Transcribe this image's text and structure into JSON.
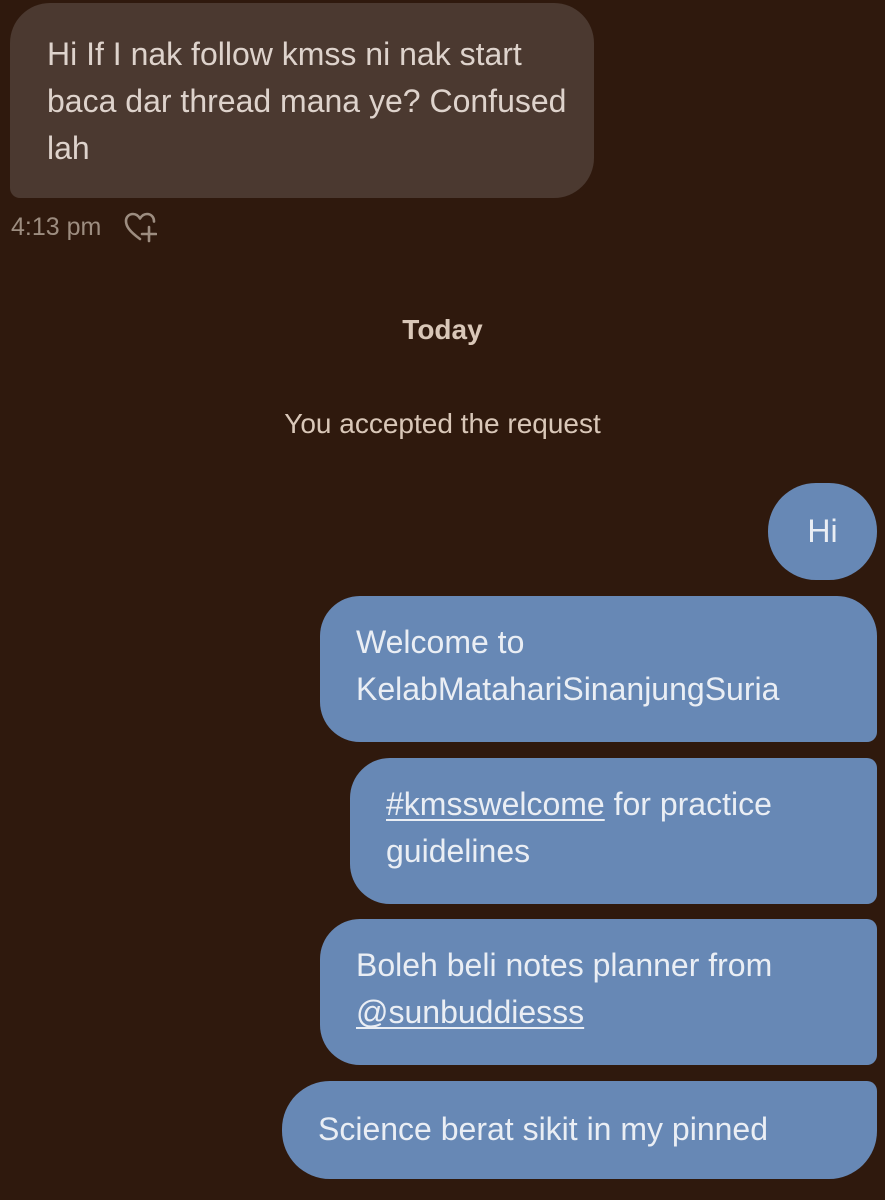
{
  "incoming": {
    "text": "Hi If I nak follow kmss ni nak start baca dar thread mana ye? Confused lah",
    "timestamp": "4:13 pm",
    "react_icon": "heart-plus-icon"
  },
  "divider": {
    "day": "Today",
    "system_note": "You accepted the request"
  },
  "outgoing": [
    {
      "text": "Hi"
    },
    {
      "text": "Welcome to KelabMatahariSinanjungSuria"
    },
    {
      "link": "#kmsswelcome",
      "text": " for practice guidelines"
    },
    {
      "text": "Boleh beli notes planner from ",
      "link": "@sunbuddiesss"
    },
    {
      "text": "Science berat sikit in my pinned"
    }
  ],
  "colors": {
    "background": "#2f190d",
    "incoming_bubble": "#4b3930",
    "outgoing_bubble": "#6788b5"
  }
}
